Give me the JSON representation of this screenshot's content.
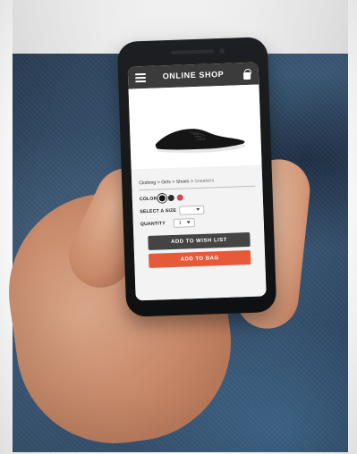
{
  "screen": {
    "app_title": "ONLINE SHOP",
    "breadcrumb": [
      "Clothing",
      "Girls",
      "Shoes",
      "Sneakers"
    ],
    "labels": {
      "color": "COLOR",
      "size": "SELECT A SIZE",
      "quantity": "QUANTITY"
    },
    "quantity_value": "1",
    "buttons": {
      "wishlist": "ADD TO WISH LIST",
      "bag": "ADD TO BAG"
    },
    "carousel_dots": 4,
    "colors": {
      "appbar": "#3b3b3b",
      "accent_button": "#e65a3a",
      "secondary_button": "#444444"
    }
  }
}
